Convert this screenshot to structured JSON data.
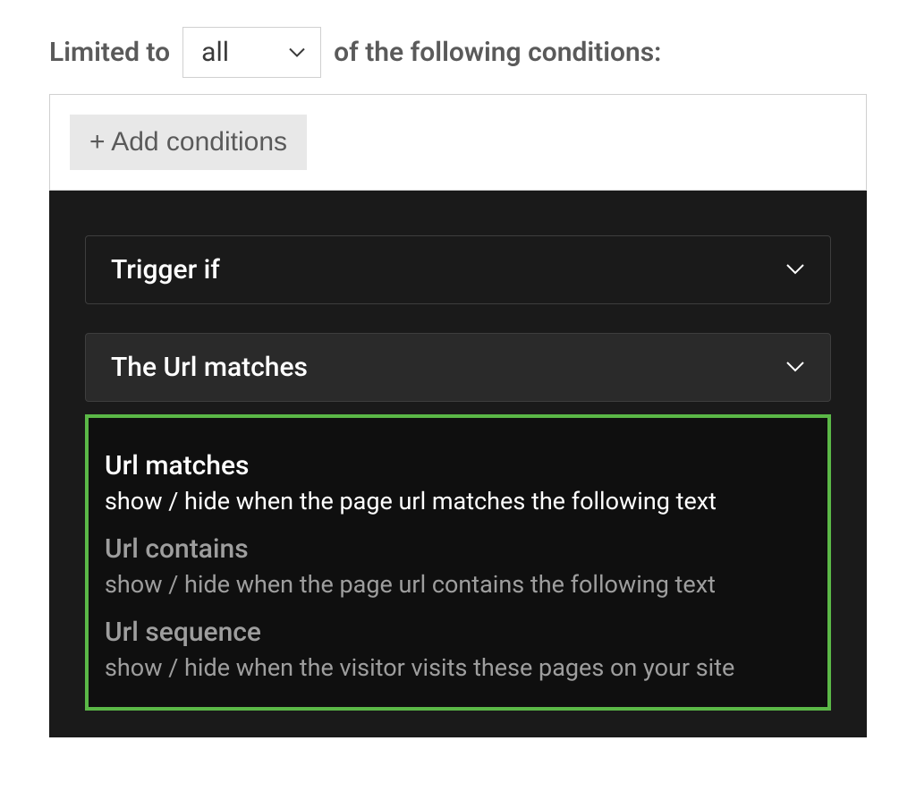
{
  "header": {
    "prefix": "Limited to",
    "select_value": "all",
    "suffix": "of the following conditions:"
  },
  "conditions": {
    "add_button": "+ Add conditions"
  },
  "dark_panel": {
    "trigger_dropdown": "Trigger if",
    "url_dropdown": "The Url matches",
    "options": [
      {
        "title": "Url matches",
        "description": "show / hide when the page url matches the following text",
        "active": true
      },
      {
        "title": "Url contains",
        "description": "show / hide when the page url contains the following text",
        "active": false
      },
      {
        "title": "Url sequence",
        "description": "show / hide when the visitor visits these pages on your site",
        "active": false
      }
    ]
  }
}
